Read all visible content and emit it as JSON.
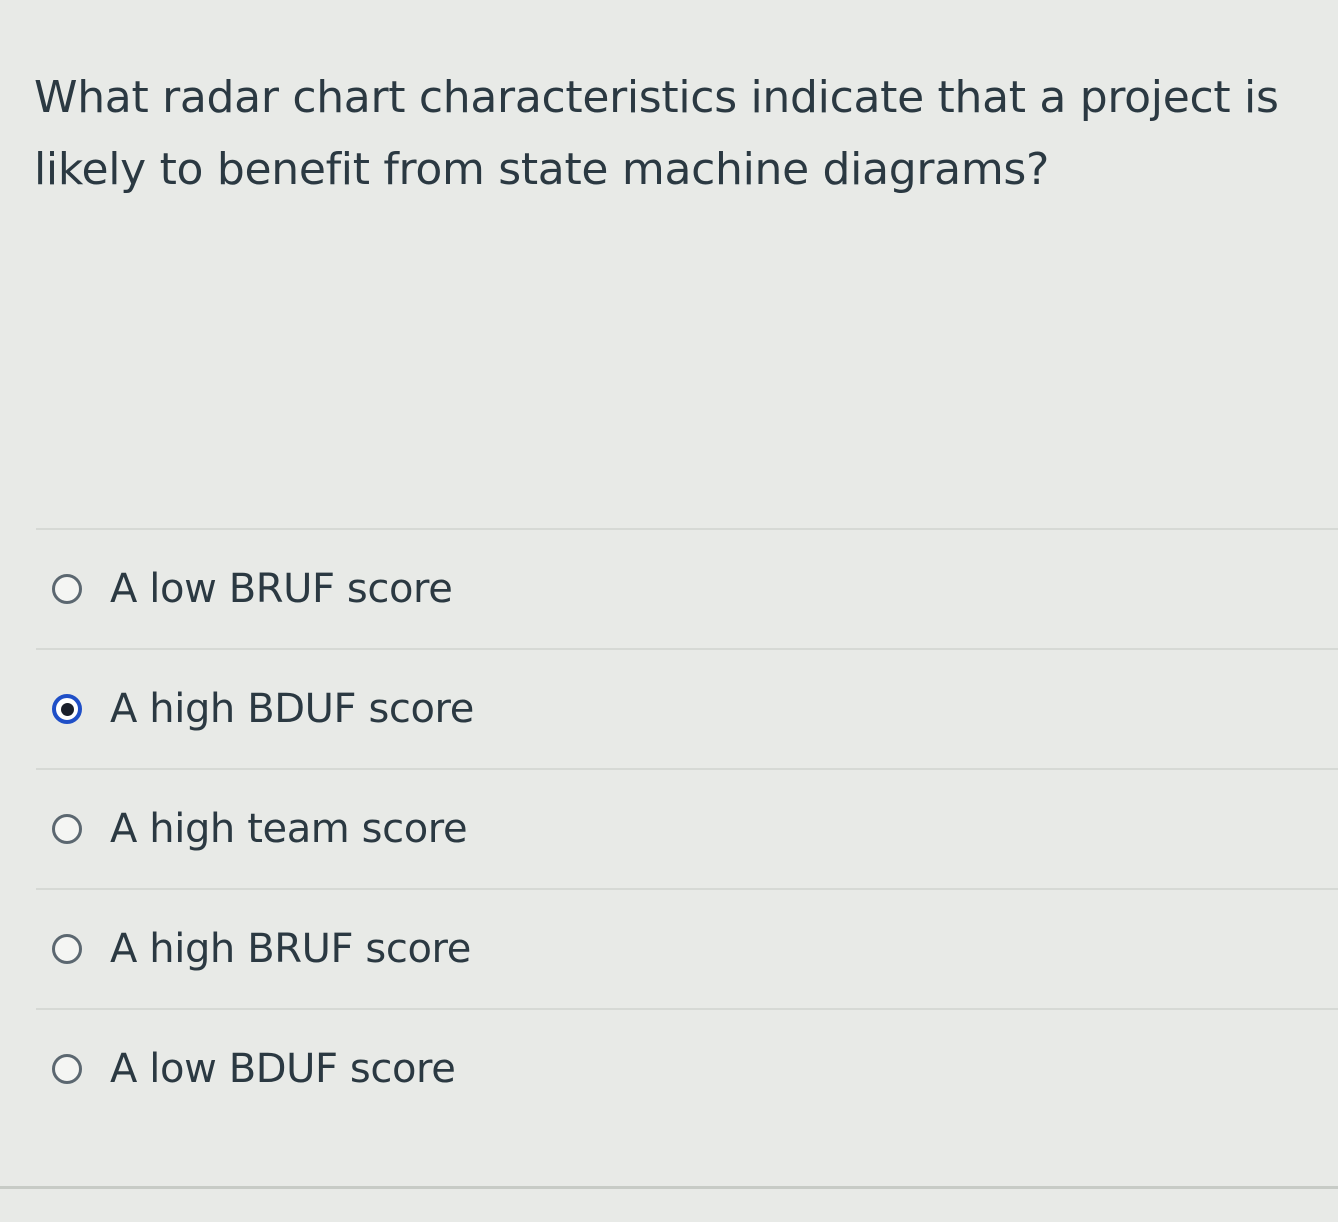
{
  "question": {
    "text": "What radar chart characteristics indicate that a project is likely to benefit from state machine diagrams?"
  },
  "answers": [
    {
      "label": "A low BRUF score",
      "selected": false
    },
    {
      "label": "A high BDUF score",
      "selected": true
    },
    {
      "label": "A high team score",
      "selected": false
    },
    {
      "label": "A high BRUF score",
      "selected": false
    },
    {
      "label": "A low BDUF score",
      "selected": false
    }
  ],
  "colors": {
    "selected_radio": "#1f4fc7",
    "text": "#2b3942",
    "background": "#e8eae7"
  }
}
